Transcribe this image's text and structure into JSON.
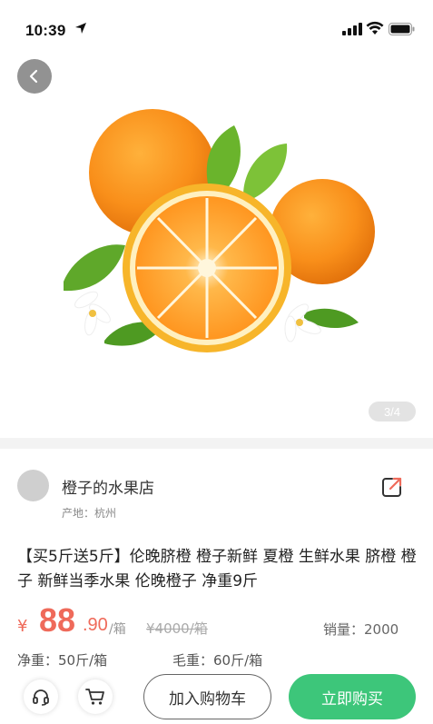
{
  "status_bar": {
    "time": "10:39"
  },
  "gallery": {
    "counter": "3/4"
  },
  "shop": {
    "name": "橙子的水果店",
    "origin": "产地：杭州"
  },
  "product": {
    "title": "【买5斤送5斤】伦晚脐橙 橙子新鲜 夏橙 生鲜水果 脐橙 橙子 新鲜当季水果 伦晚橙子 净重9斤",
    "currency": "¥",
    "price_int": "88",
    "price_dec": ".90",
    "price_unit": "/箱",
    "original_price": "¥4000/箱",
    "sales": "销量：2000",
    "net_weight": "净重：50斤/箱",
    "gross_weight": "毛重：60斤/箱"
  },
  "actions": {
    "add_to_cart": "加入购物车",
    "buy_now": "立即购买"
  },
  "colors": {
    "accent_price": "#ef6a5a",
    "buy_button": "#3dc67a"
  },
  "icons": [
    "location-arrow-icon",
    "signal-icon",
    "wifi-icon",
    "battery-icon",
    "back-icon",
    "share-icon",
    "headset-icon",
    "cart-icon"
  ]
}
